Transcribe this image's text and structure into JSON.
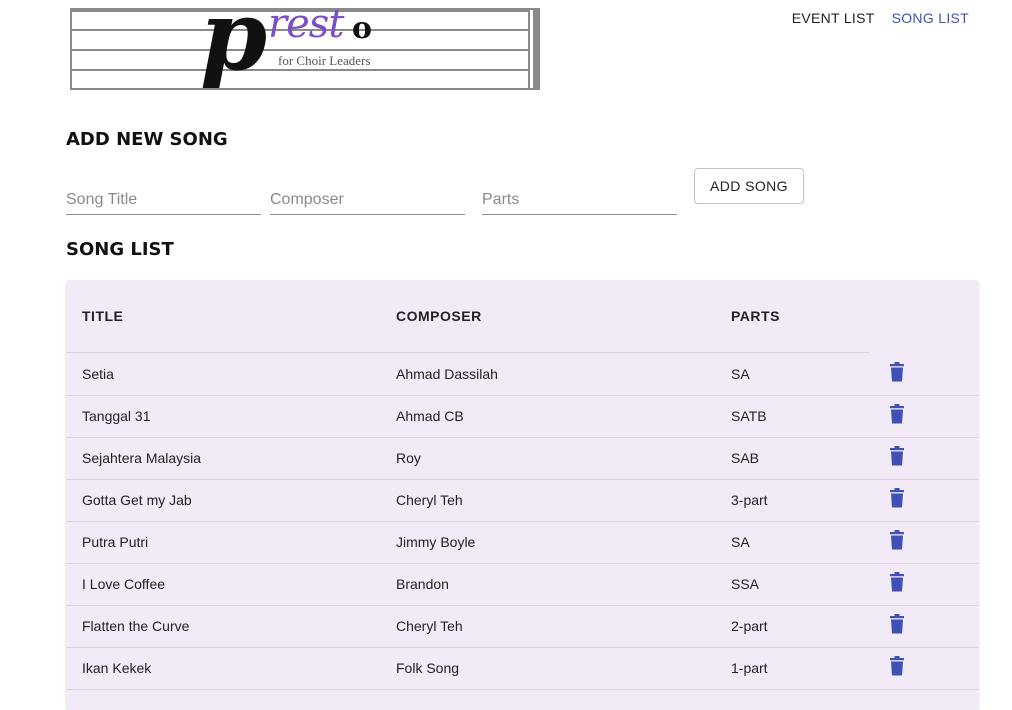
{
  "logo": {
    "letter_p": "p",
    "letters_rest": "rest",
    "letter_o": "o",
    "tagline": "for Choir Leaders"
  },
  "nav": {
    "event_list": "EVENT LIST",
    "song_list": "SONG LIST"
  },
  "add_section": {
    "heading": "ADD NEW SONG",
    "title_placeholder": "Song Title",
    "composer_placeholder": "Composer",
    "parts_placeholder": "Parts",
    "title_value": "",
    "composer_value": "",
    "parts_value": "",
    "button_label": "ADD SONG"
  },
  "list_section": {
    "heading": "SONG LIST",
    "columns": {
      "title": "TITLE",
      "composer": "COMPOSER",
      "parts": "PARTS"
    },
    "rows": [
      {
        "title": "Setia",
        "composer": "Ahmad Dassilah",
        "parts": "SA"
      },
      {
        "title": "Tanggal 31",
        "composer": "Ahmad CB",
        "parts": "SATB"
      },
      {
        "title": "Sejahtera Malaysia",
        "composer": "Roy",
        "parts": "SAB"
      },
      {
        "title": "Gotta Get my Jab",
        "composer": "Cheryl Teh",
        "parts": "3-part"
      },
      {
        "title": "Putra Putri",
        "composer": "Jimmy Boyle",
        "parts": "SA"
      },
      {
        "title": "I Love Coffee",
        "composer": "Brandon",
        "parts": "SSA"
      },
      {
        "title": "Flatten the Curve",
        "composer": "Cheryl Teh",
        "parts": "2-part"
      },
      {
        "title": "Ikan Kekek",
        "composer": "Folk Song",
        "parts": "1-part"
      }
    ]
  },
  "colors": {
    "accent": "#3f51b5",
    "table_bg": "#f2eaf6",
    "logo_purple": "#7b4fc7"
  },
  "icons": {
    "delete": "trash-icon"
  }
}
